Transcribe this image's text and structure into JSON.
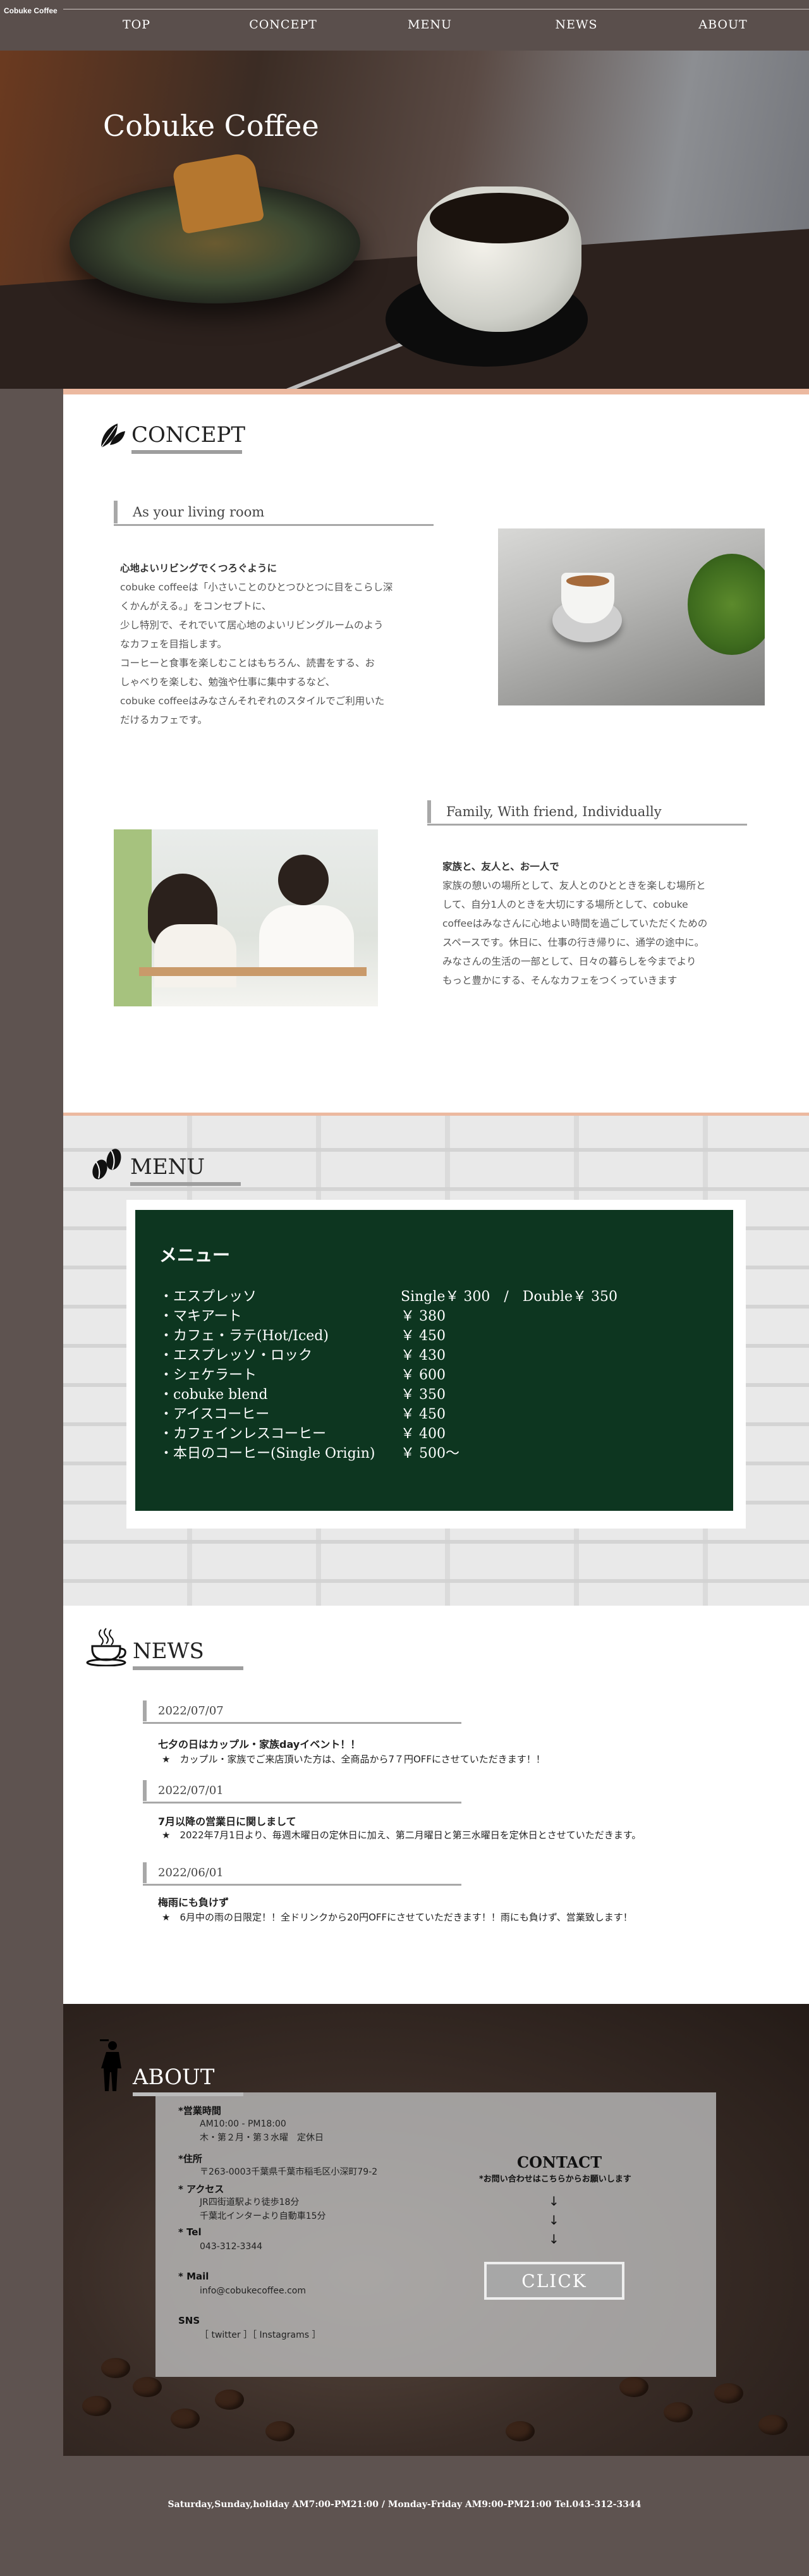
{
  "header": {
    "logo": "Cobuke Coffee",
    "nav": [
      "TOP",
      "CONCEPT",
      "MENU",
      "NEWS",
      "ABOUT"
    ]
  },
  "hero": {
    "title": "Cobuke Coffee"
  },
  "concept": {
    "title": "CONCEPT",
    "block1": {
      "heading": "As your living room",
      "lead": "心地よいリビングでくつろぐように",
      "lines": [
        "cobuke coffeeは「小さいことのひとつひとつに目をこらし深",
        "くかんがえる。」をコンセプトに、",
        "少し特別で、それでいて居心地のよいリビングルームのよう",
        "なカフェを目指します。",
        "コーヒーと食事を楽しむことはもちろん、読書をする、お",
        "しゃべりを楽しむ、勉強や仕事に集中するなど、",
        "cobuke coffeeはみなさんそれぞれのスタイルでご利用いた",
        "だけるカフェです。"
      ]
    },
    "block2": {
      "heading": "Family, With friend, Individually",
      "lead": "家族と、友人と、お一人で",
      "lines": [
        "家族の憩いの場所として、友人とのひとときを楽しむ場所と",
        "して、自分1人のときを大切にする場所として、cobuke",
        "coffeeはみなさんに心地よい時間を過ごしていただくための",
        "スペースです。休日に、仕事の行き帰りに、通学の途中に。",
        "みなさんの生活の一部として、日々の暮らしを今までより",
        "もっと豊かにする、そんなカフェをつくっていきます"
      ]
    }
  },
  "menu": {
    "title": "MENU",
    "board_title": "メニュー",
    "items": [
      "・エスプレッソ",
      "・マキアート",
      "・カフェ・ラテ(Hot/Iced)",
      "・エスプレッソ・ロック",
      "・シェケラート",
      "・cobuke blend",
      "・アイスコーヒー",
      "・カフェインレスコーヒー",
      "・本日のコーヒー(Single Origin)"
    ],
    "prices": [
      "Single￥ 300　/　Double￥ 350",
      "￥ 380",
      "￥ 450",
      "￥ 430",
      "￥ 600",
      "￥ 350",
      "￥ 450",
      "￥ 400",
      "￥ 500〜"
    ]
  },
  "news": {
    "title": "NEWS",
    "items": [
      {
        "date": "2022/07/07",
        "title": "七夕の日はカップル・家族dayイベント！！",
        "text": "★　カップル・家族でご来店頂いた方は、全商品から7７円OFFにさせていただきます！！"
      },
      {
        "date": "2022/07/01",
        "title": "7月以降の営業日に関しまして",
        "text": "★　2022年7月1日より、毎週木曜日の定休日に加え、第二月曜日と第三水曜日を定休日とさせていただきます。"
      },
      {
        "date": "2022/06/01",
        "title": "梅雨にも負けず",
        "text": "★　6月中の雨の日限定！！全ドリンクから20円OFFにさせていただきます！！雨にも負けず、営業致します！"
      }
    ]
  },
  "about": {
    "title": "ABOUT",
    "hours_label": "*営業時間",
    "hours": [
      "AM10:00 - PM18:00",
      "木・第２月・第３水曜　定休日"
    ],
    "address_label": "*住所",
    "address": "〒263-0003千葉県千葉市稲毛区小深町79-2",
    "access_label": "* アクセス",
    "access": [
      "JR四街道駅より徒歩18分",
      "千葉北インターより自動車15分"
    ],
    "tel_label": "* Tel",
    "tel": "043-312-3344",
    "mail_label": "* Mail",
    "mail": "info@cobukecoffee.com",
    "sns_label": "SNS",
    "sns": "［ twitter ］［ Instagrams ］",
    "contact_title": "CONTACT",
    "contact_note": "*お問い合わせはこちらからお願いします",
    "arrow": "↓",
    "button": "CLICK"
  },
  "footer": {
    "text": "Saturday,Sunday,holiday AM7:00-PM21:00 / Monday-Friday AM9:00-PM21:00 Tel.043-312-3344"
  },
  "colors": {
    "header_bg": "#5a4f4c",
    "accent_peach": "#ecb9a0",
    "blackboard": "#0d3620",
    "body_bg": "#5e5350"
  }
}
